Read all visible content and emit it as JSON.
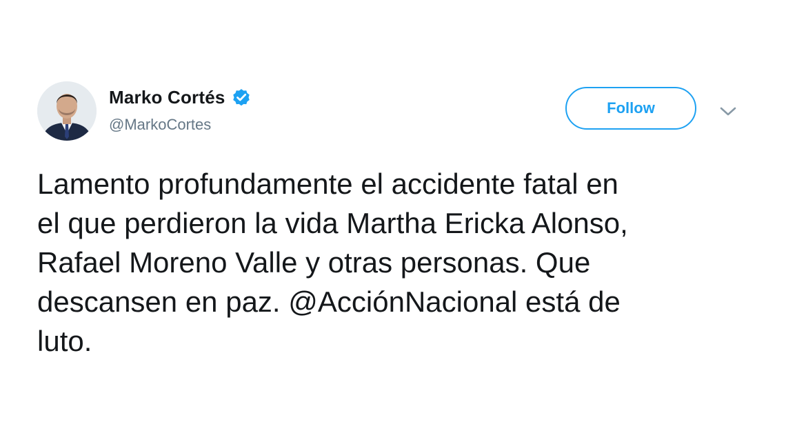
{
  "author": {
    "display_name": "Marko Cortés",
    "handle": "@MarkoCortes",
    "verified": true
  },
  "actions": {
    "follow_label": "Follow"
  },
  "tweet": {
    "text": "Lamento profundamente el accidente fatal en\nel que perdieron la vida Martha Ericka Alonso,\nRafael Moreno Valle y otras personas. Que\ndescansen en paz. @AcciónNacional está de\nluto."
  },
  "icons": {
    "verified": "verified-badge-icon",
    "more": "chevron-down-icon"
  },
  "colors": {
    "accent": "#1da1f2",
    "text": "#14171a",
    "secondary_text": "#657786"
  }
}
